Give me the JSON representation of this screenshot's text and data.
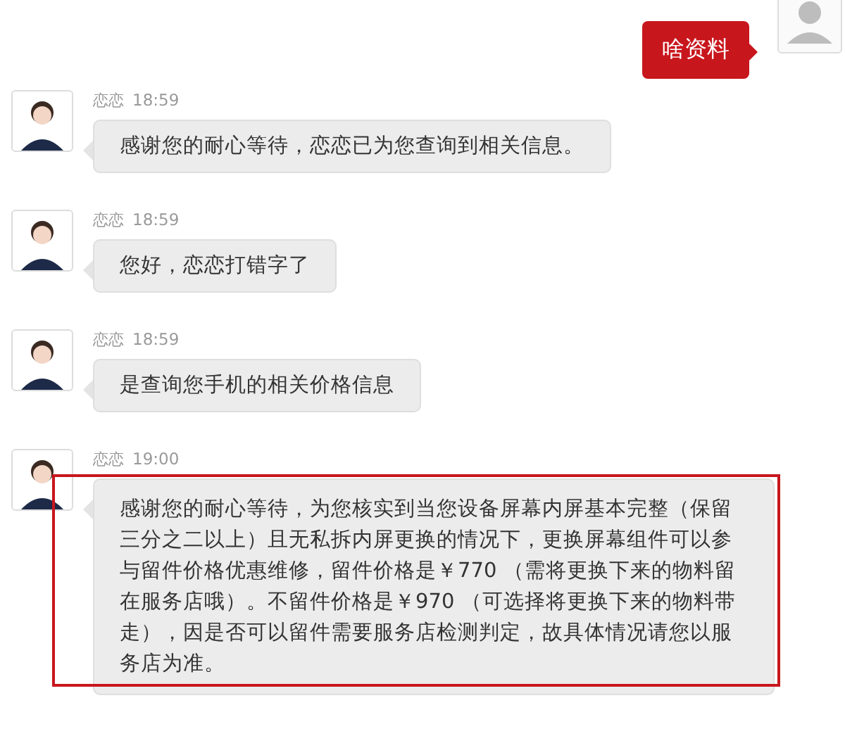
{
  "messages": [
    {
      "kind": "outgoing",
      "text": "啥资料",
      "highlighted": false
    },
    {
      "kind": "incoming",
      "sender": "恋恋",
      "time": "18:59",
      "text": "感谢您的耐心等待，恋恋已为您查询到相关信息。",
      "highlighted": false
    },
    {
      "kind": "incoming",
      "sender": "恋恋",
      "time": "18:59",
      "text": "您好，恋恋打错字了",
      "highlighted": false
    },
    {
      "kind": "incoming",
      "sender": "恋恋",
      "time": "18:59",
      "text": "是查询您手机的相关价格信息",
      "highlighted": false
    },
    {
      "kind": "incoming",
      "sender": "恋恋",
      "time": "19:00",
      "text": "感谢您的耐心等待，为您核实到当您设备屏幕内屏基本完整（保留三分之二以上）且无私拆内屏更换的情况下，更换屏幕组件可以参与留件价格优惠维修，留件价格是￥770 （需将更换下来的物料留在服务店哦）。不留件价格是￥970 （可选择将更换下来的物料带走），因是否可以留件需要服务店检测判定，故具体情况请您以服务店为准。",
      "highlighted": true
    }
  ]
}
